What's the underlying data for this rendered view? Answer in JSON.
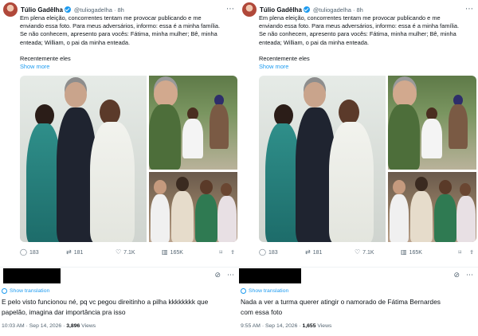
{
  "posts": [
    {
      "quoted": {
        "author": "Túlio Gadêlha",
        "handle": "@tuliogadelha",
        "dot": "·",
        "time": "8h",
        "lines": [
          "Em plena eleição, concorrentes tentam me provocar publicando e me",
          "enviando essa foto. Para meus adversários, informo: essa é a minha família.",
          "Se não conhecem, apresento para vocês: Fátima, minha mulher; Bê, minha",
          "enteada; William, o pai da minha enteada."
        ],
        "line_last": "Recentemente eles",
        "show_more": "Show more",
        "stats": {
          "replies": "183",
          "reposts": "181",
          "likes": "7.1K",
          "views": "165K"
        }
      },
      "reply": {
        "show_translation": "Show translation",
        "lines": [
          "E pelo visto funcionou né, pq vc pegou direitinho a pilha kkkkkkkk que",
          "papelão, imagina dar importância pra isso"
        ],
        "meta_time": "10:03 AM · Sep 14, 2026 · ",
        "meta_views_count": "3,896",
        "meta_views_label": " Views"
      }
    },
    {
      "quoted": {
        "author": "Túlio Gadêlha",
        "handle": "@tuliogadelha",
        "dot": "·",
        "time": "8h",
        "lines": [
          "Em plena eleição, concorrentes tentam me provocar publicando e me",
          "enviando essa foto. Para meus adversários, informo: essa é a minha família.",
          "Se não conhecem, apresento para vocês: Fátima, minha mulher; Bê, minha",
          "enteada; William, o pai da minha enteada."
        ],
        "line_last": "Recentemente eles",
        "show_more": "Show more",
        "stats": {
          "replies": "183",
          "reposts": "181",
          "likes": "7.1K",
          "views": "165K"
        }
      },
      "reply": {
        "show_translation": "Show translation",
        "lines": [
          "Nada a ver a turma querer atingir o namorado de Fátima Bernardes",
          "com essa foto"
        ],
        "meta_time": "9:55 AM · Sep 14, 2026 · ",
        "meta_views_count": "1,655",
        "meta_views_label": " Views"
      }
    }
  ],
  "icons": {
    "reply": "reply-icon",
    "repost": "repost-icon",
    "like": "heart-icon",
    "views": "views-icon",
    "bookmark": "bookmark-icon",
    "share": "share-icon",
    "more": "more-icon",
    "grok": "grok-icon",
    "globe": "globe-icon"
  },
  "colors": {
    "accent": "#1d9bf0",
    "text": "#0f1419",
    "muted": "#536471",
    "redaction": "#000000"
  }
}
